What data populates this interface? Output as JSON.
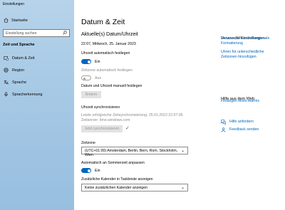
{
  "window": {
    "title": "Einstellungen",
    "minimize": "—",
    "maximize": "☐",
    "close": "✕"
  },
  "sidebar": {
    "home": "Startseite",
    "search_placeholder": "Einstellung suchen",
    "section": "Zeit und Sprache",
    "items": [
      {
        "label": "Datum & Zeit",
        "icon": "calendar-clock-icon"
      },
      {
        "label": "Region",
        "icon": "globe-icon"
      },
      {
        "label": "Sprache",
        "icon": "language-icon"
      },
      {
        "label": "Spracherkennung",
        "icon": "microphone-icon"
      }
    ]
  },
  "main": {
    "title": "Datum & Zeit",
    "current_heading": "Aktuelle(s) Datum/Uhrzeit",
    "current_value": "22:07, Mittwoch, 25. Januar 2023",
    "auto_time_label": "Uhrzeit automatisch festlegen",
    "auto_time_state": "Ein",
    "auto_zone_label": "Zeitzone automatisch festlegen",
    "auto_zone_state": "Aus",
    "manual_label": "Datum und Uhrzeit manuell festlegen",
    "change_button": "Ändern",
    "sync_heading": "Uhrzeit synchronisieren",
    "sync_last": "Letzte erfolgreiche Zeitsynchronisierung: 25.01.2023 22:07:05",
    "sync_server": "Zeitserver: time.windows.com",
    "sync_button": "Jetzt synchronisieren",
    "tz_label": "Zeitzone",
    "tz_value": "(UTC+01:00) Amsterdam, Berlin, Bern, Rom, Stockholm, Wien",
    "dst_label": "Automatisch an Sommerzeit anpassen",
    "dst_state": "Ein",
    "cal_label": "Zusätzliche Kalender in Taskleiste anzeigen",
    "cal_value": "Keine zusätzlichen Kalender anzeigen"
  },
  "related": {
    "heading": "Verwandte Einstellungen",
    "link1": "Datums-, Uhrzeit- & regionale Formatierung",
    "link2": "Uhren für unterschiedliche Zeitzonen hinzufügen",
    "help_heading": "Hilfe aus dem Web",
    "help_link": "Festlegen eines Alarms",
    "get_help": "Hilfe anfordern",
    "feedback": "Feedback senden"
  },
  "colors": {
    "accent": "#0067c0",
    "sidebar": "#a9cbe6"
  }
}
